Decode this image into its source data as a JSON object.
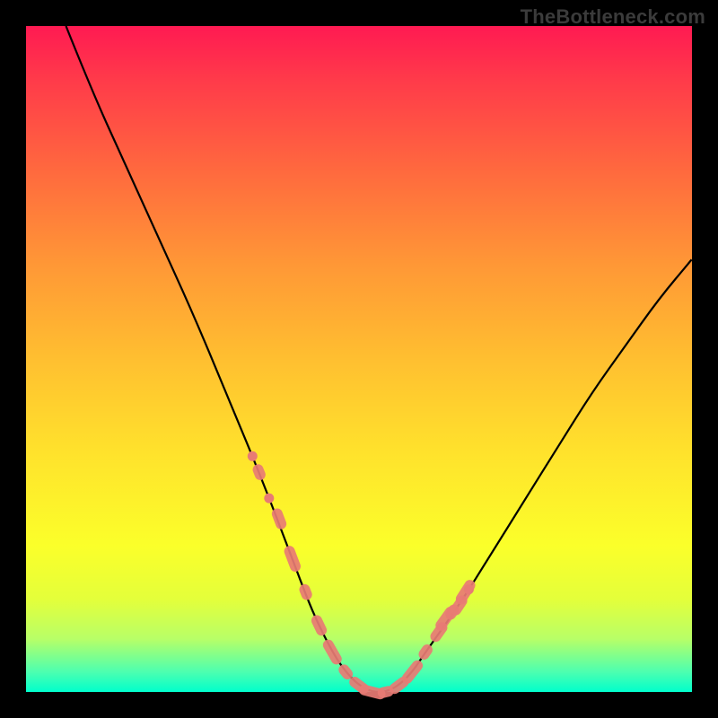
{
  "watermark": "TheBottleneck.com",
  "chart_data": {
    "type": "line",
    "title": "",
    "xlabel": "",
    "ylabel": "",
    "xlim": [
      0,
      100
    ],
    "ylim": [
      0,
      100
    ],
    "grid": false,
    "legend": false,
    "series": [
      {
        "name": "bottleneck-curve",
        "x": [
          6,
          10,
          15,
          20,
          25,
          30,
          35,
          40,
          43,
          46,
          48,
          50,
          52,
          54,
          56,
          58,
          60,
          65,
          70,
          75,
          80,
          85,
          90,
          95,
          100
        ],
        "y": [
          100,
          90,
          79,
          68,
          57,
          45,
          33,
          20,
          12,
          6,
          3,
          1,
          0,
          0,
          1,
          3,
          6,
          13,
          21,
          29,
          37,
          45,
          52,
          59,
          65
        ]
      }
    ],
    "markers": [
      {
        "name": "highlight-dots",
        "x": [
          35,
          38,
          40,
          42,
          44,
          46,
          48,
          50,
          52,
          54,
          56,
          58,
          60,
          62,
          63,
          64,
          65,
          66
        ],
        "y": [
          33,
          26,
          20,
          15,
          10,
          6,
          3,
          1,
          0,
          0,
          1,
          3,
          6,
          9,
          11,
          12,
          13,
          15
        ]
      }
    ]
  }
}
